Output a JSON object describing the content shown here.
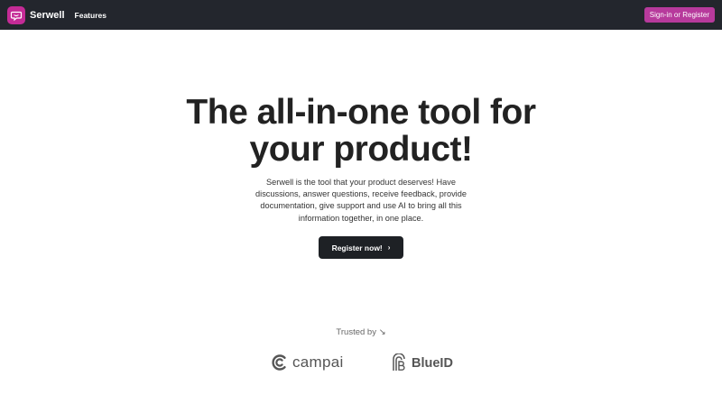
{
  "navbar": {
    "brand_name": "Serwell",
    "links": [
      {
        "label": "Features"
      }
    ],
    "signin_label": "Sign-in or Register"
  },
  "hero": {
    "title_line1": "The all-in-one tool for",
    "title_line2": "your product!",
    "description": "Serwell is the tool that your product deserves! Have discussions, answer questions, receive feedback, provide documentation, give support and use AI to bring all this information together, in one place.",
    "cta_label": "Register now!",
    "cta_icon": "chevron-right-icon"
  },
  "trusted": {
    "label": "Trusted by ↘",
    "logos": [
      {
        "name": "campai",
        "icon": "campai-logo-icon"
      },
      {
        "name": "BlueID",
        "icon": "blueid-logo-icon"
      }
    ]
  },
  "colors": {
    "navbar_bg": "#23262d",
    "brand_accent": "#c42b96",
    "signin_bg": "#b73a9c",
    "cta_bg": "#1e2125"
  }
}
